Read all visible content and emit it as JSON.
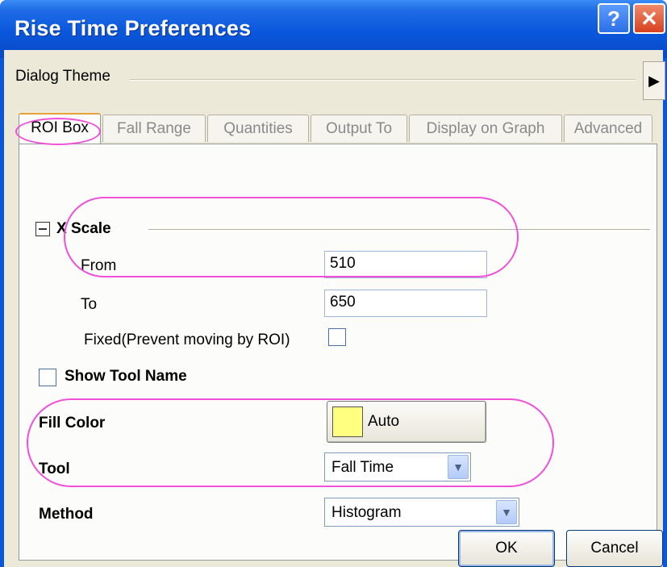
{
  "window": {
    "title": "Rise Time Preferences",
    "help_glyph": "?",
    "close_glyph": "✕"
  },
  "theme": {
    "label": "Dialog Theme",
    "arrow_glyph": "▶"
  },
  "tabs": [
    {
      "label": "ROI Box",
      "active": true
    },
    {
      "label": "Fall Range",
      "active": false
    },
    {
      "label": "Quantities",
      "active": false
    },
    {
      "label": "Output To",
      "active": false
    },
    {
      "label": "Display on Graph",
      "active": false
    },
    {
      "label": "Advanced",
      "active": false
    }
  ],
  "roi_box": {
    "section_title": "X Scale",
    "from_label": "From",
    "from_value": "510",
    "to_label": "To",
    "to_value": "650",
    "fixed_label": "Fixed(Prevent moving by ROI)",
    "fixed_checked": false,
    "show_tool_name_label": "Show Tool Name",
    "show_tool_name_checked": false,
    "fill_color_label": "Fill Color",
    "fill_color_value": "Auto",
    "fill_color_swatch": "#ffff80",
    "tool_label": "Tool",
    "tool_value": "Fall Time",
    "method_label": "Method",
    "method_value": "Histogram",
    "dropdown_glyph": "▼"
  },
  "buttons": {
    "ok": "OK",
    "cancel": "Cancel"
  },
  "colors": {
    "titlebar": "#0a57dc",
    "highlight": "#f14fd8",
    "dialog_bg": "#ece9d8"
  }
}
